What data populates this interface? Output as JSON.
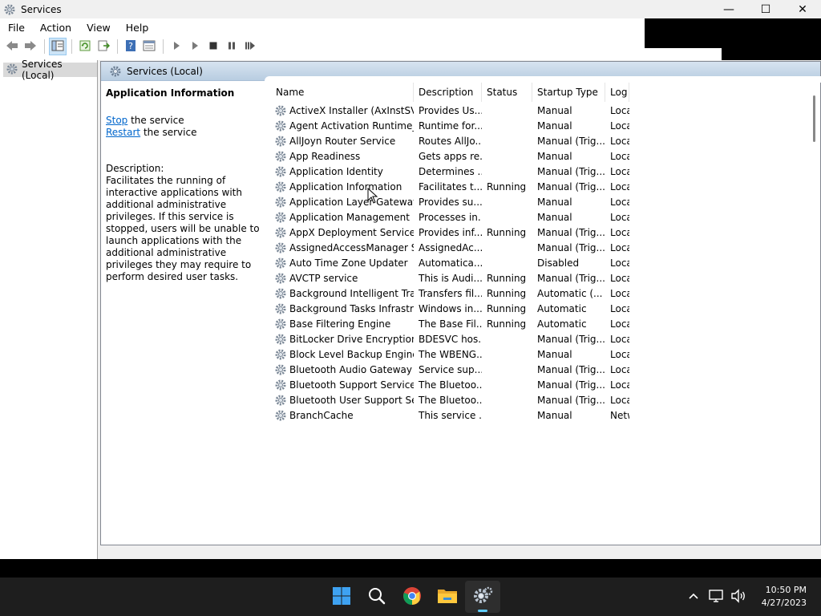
{
  "window": {
    "title": "Services",
    "controls": {
      "minimize": "—",
      "maximize": "☐",
      "close": "✕"
    }
  },
  "menu": [
    "File",
    "Action",
    "View",
    "Help"
  ],
  "toolbar_icons": [
    "back-arrow-icon",
    "forward-arrow-icon",
    "show-hide-console-tree-icon",
    "refresh-icon",
    "export-list-icon",
    "help-icon",
    "properties-icon",
    "start-service-icon",
    "start-service-alt-icon",
    "stop-service-icon",
    "pause-service-icon",
    "restart-service-icon"
  ],
  "tree": {
    "item": "Services (Local)"
  },
  "content": {
    "header": "Services (Local)",
    "extended": {
      "title": "Application Information",
      "stop_link": "Stop",
      "stop_rest": " the service",
      "restart_link": "Restart",
      "restart_rest": " the service",
      "desc_label": "Description:",
      "desc_text": "Facilitates the running of interactive applications with additional administrative privileges.  If this service is stopped, users will be unable to launch applications with the additional administrative privileges they may require to perform desired user tasks."
    },
    "columns": [
      "Name",
      "Description",
      "Status",
      "Startup Type",
      "Log"
    ],
    "sort_indicator": "^",
    "rows": [
      [
        "ActiveX Installer (AxInstSV)",
        "Provides Us...",
        "",
        "Manual",
        "Loca"
      ],
      [
        "Agent Activation Runtime_...",
        "Runtime for...",
        "",
        "Manual",
        "Loca"
      ],
      [
        "AllJoyn Router Service",
        "Routes AllJo...",
        "",
        "Manual (Trig...",
        "Loca"
      ],
      [
        "App Readiness",
        "Gets apps re...",
        "",
        "Manual",
        "Loca"
      ],
      [
        "Application Identity",
        "Determines ...",
        "",
        "Manual (Trig...",
        "Loca"
      ],
      [
        "Application Information",
        "Facilitates t...",
        "Running",
        "Manual (Trig...",
        "Loca"
      ],
      [
        "Application Layer Gateway ...",
        "Provides su...",
        "",
        "Manual",
        "Loca"
      ],
      [
        "Application Management",
        "Processes in...",
        "",
        "Manual",
        "Loca"
      ],
      [
        "AppX Deployment Service (...",
        "Provides inf...",
        "Running",
        "Manual (Trig...",
        "Loca"
      ],
      [
        "AssignedAccessManager Se...",
        "AssignedAc...",
        "",
        "Manual (Trig...",
        "Loca"
      ],
      [
        "Auto Time Zone Updater",
        "Automatica...",
        "",
        "Disabled",
        "Loca"
      ],
      [
        "AVCTP service",
        "This is Audi...",
        "Running",
        "Manual (Trig...",
        "Loca"
      ],
      [
        "Background Intelligent Tran...",
        "Transfers fil...",
        "Running",
        "Automatic (...",
        "Loca"
      ],
      [
        "Background Tasks Infrastruc...",
        "Windows in...",
        "Running",
        "Automatic",
        "Loca"
      ],
      [
        "Base Filtering Engine",
        "The Base Fil...",
        "Running",
        "Automatic",
        "Loca"
      ],
      [
        "BitLocker Drive Encryption ...",
        "BDESVC hos...",
        "",
        "Manual (Trig...",
        "Loca"
      ],
      [
        "Block Level Backup Engine ...",
        "The WBENG...",
        "",
        "Manual",
        "Loca"
      ],
      [
        "Bluetooth Audio Gateway S...",
        "Service sup...",
        "",
        "Manual (Trig...",
        "Loca"
      ],
      [
        "Bluetooth Support Service",
        "The Bluetoo...",
        "",
        "Manual (Trig...",
        "Loca"
      ],
      [
        "Bluetooth User Support Ser...",
        "The Bluetoo...",
        "",
        "Manual (Trig...",
        "Loca"
      ],
      [
        "BranchCache",
        "This service ...",
        "",
        "Manual",
        "Netw"
      ]
    ]
  },
  "taskbar": {
    "apps": [
      "start-icon",
      "search-icon",
      "chrome-icon",
      "file-explorer-icon",
      "services-icon"
    ],
    "active_app": "services-icon",
    "time": "10:50 PM",
    "date": "4/27/2023"
  },
  "colors": {
    "accent": "#60cdff",
    "link": "#0066cc",
    "header_gradient_top": "#d7e4f0",
    "header_gradient_bottom": "#b8cde1"
  }
}
